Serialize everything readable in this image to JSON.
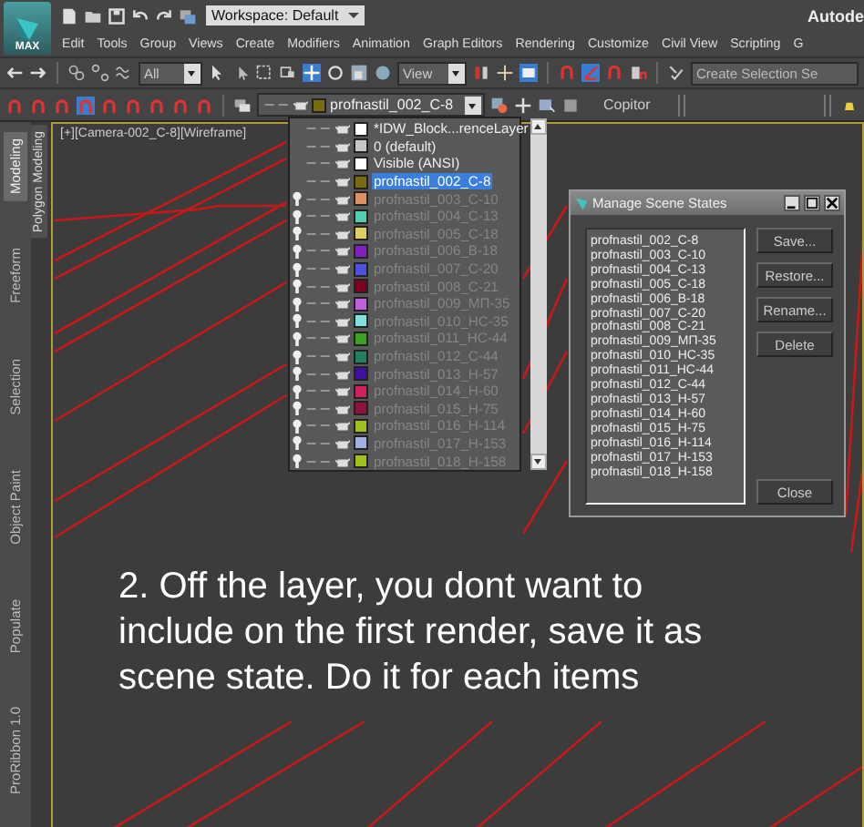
{
  "title_bar": {
    "logo_label": "MAX",
    "workspace": "Workspace: Default",
    "title": "Autode"
  },
  "menu": [
    "Edit",
    "Tools",
    "Group",
    "Views",
    "Create",
    "Modifiers",
    "Animation",
    "Graph Editors",
    "Rendering",
    "Customize",
    "Civil View",
    "Scripting",
    "G"
  ],
  "main_toolbar": {
    "selection_filter": "All",
    "reference_coordinate": "View",
    "named_selection": "Create Selection Se"
  },
  "layer_toolbar": {
    "current_layer": {
      "name": "profnastil_002_C-8",
      "color": "#7a6a10"
    },
    "label": "Copitor"
  },
  "ribbon": {
    "tabs": [
      {
        "label": "Modeling",
        "selected": true
      },
      {
        "label": "Freeform",
        "selected": false
      },
      {
        "label": "Selection",
        "selected": false
      },
      {
        "label": "Object Paint",
        "selected": false
      },
      {
        "label": "Populate",
        "selected": false
      },
      {
        "label": "ProRibbon 1.0",
        "selected": false
      }
    ],
    "panel_tab": "Polygon Modeling"
  },
  "viewport": {
    "label": "[+][Camera-002_C-8][Wireframe]"
  },
  "layer_list": [
    {
      "name": "*IDW_Block...renceLayer",
      "color": "#ffffff",
      "hidden": false,
      "selected": false
    },
    {
      "name": "0 (default)",
      "color": "#c8c8c8",
      "hidden": false,
      "selected": false
    },
    {
      "name": "Visible (ANSI)",
      "color": "#ffffff",
      "hidden": false,
      "selected": false
    },
    {
      "name": "profnastil_002_C-8",
      "color": "#7a6a10",
      "hidden": false,
      "selected": true
    },
    {
      "name": "profnastil_003_C-10",
      "color": "#e09060",
      "hidden": true,
      "selected": false
    },
    {
      "name": "profnastil_004_C-13",
      "color": "#50d0b0",
      "hidden": true,
      "selected": false
    },
    {
      "name": "profnastil_005_C-18",
      "color": "#e0d060",
      "hidden": true,
      "selected": false
    },
    {
      "name": "profnastil_006_B-18",
      "color": "#8020c0",
      "hidden": true,
      "selected": false
    },
    {
      "name": "profnastil_007_C-20",
      "color": "#5050e0",
      "hidden": true,
      "selected": false
    },
    {
      "name": "profnastil_008_C-21",
      "color": "#800020",
      "hidden": true,
      "selected": false
    },
    {
      "name": "profnastil_009_МП-35",
      "color": "#c060e0",
      "hidden": true,
      "selected": false
    },
    {
      "name": "profnastil_010_HC-35",
      "color": "#80e0e0",
      "hidden": true,
      "selected": false
    },
    {
      "name": "profnastil_011_HC-44",
      "color": "#40a020",
      "hidden": true,
      "selected": false
    },
    {
      "name": "profnastil_012_C-44",
      "color": "#208060",
      "hidden": true,
      "selected": false
    },
    {
      "name": "profnastil_013_H-57",
      "color": "#4010a0",
      "hidden": true,
      "selected": false
    },
    {
      "name": "profnastil_014_H-60",
      "color": "#d02060",
      "hidden": true,
      "selected": false
    },
    {
      "name": "profnastil_015_H-75",
      "color": "#901040",
      "hidden": true,
      "selected": false
    },
    {
      "name": "profnastil_016_H-114",
      "color": "#a0c020",
      "hidden": true,
      "selected": false
    },
    {
      "name": "profnastil_017_H-153",
      "color": "#a0b0e0",
      "hidden": true,
      "selected": false
    },
    {
      "name": "profnastil_018_H-158",
      "color": "#a0c020",
      "hidden": true,
      "selected": false
    }
  ],
  "scene_states_dialog": {
    "title": "Manage Scene States",
    "states": [
      "profnastil_002_C-8",
      "profnastil_003_C-10",
      "profnastil_004_C-13",
      "profnastil_005_C-18",
      "profnastil_006_B-18",
      "profnastil_007_C-20",
      "profnastil_008_C-21",
      "profnastil_009_МП-35",
      "profnastil_010_HC-35",
      "profnastil_011_HC-44",
      "profnastil_012_C-44",
      "profnastil_013_H-57",
      "profnastil_014_H-60",
      "profnastil_015_H-75",
      "profnastil_016_H-114",
      "profnastil_017_H-153",
      "profnastil_018_H-158"
    ],
    "buttons": [
      "Save...",
      "Restore...",
      "Rename...",
      "Delete"
    ],
    "close": "Close"
  },
  "caption": "2. Off the layer, you dont want to include on the first render, save it as scene state. Do it for each items"
}
